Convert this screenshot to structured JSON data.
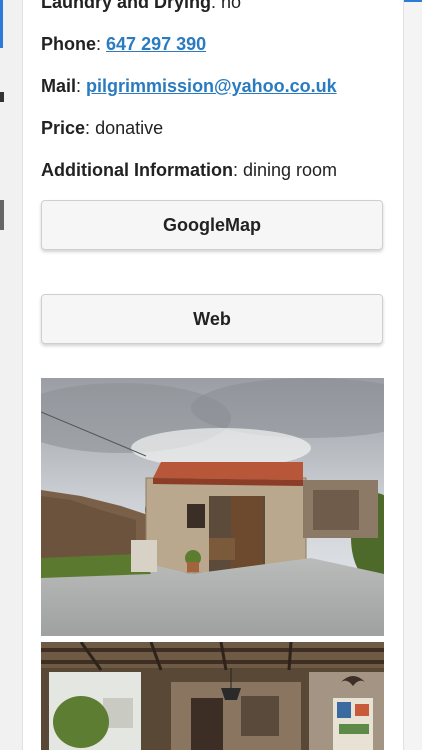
{
  "details": {
    "laundry": {
      "label": "Laundry and Drying",
      "value": "no"
    },
    "phone": {
      "label": "Phone",
      "value": "647 297 390"
    },
    "mail": {
      "label": "Mail",
      "value": "pilgrimmission@yahoo.co.uk"
    },
    "price": {
      "label": "Price",
      "value": "donative"
    },
    "additional": {
      "label": "Additional Information",
      "value": "dining room"
    }
  },
  "buttons": {
    "map_label": "GoogleMap",
    "web_label": "Web"
  },
  "colors": {
    "link": "#2a7bc0",
    "accent": "#2c7bd6"
  },
  "photos": [
    {
      "name": "albergue-exterior-photo"
    },
    {
      "name": "dining-room-interior-photo"
    }
  ]
}
